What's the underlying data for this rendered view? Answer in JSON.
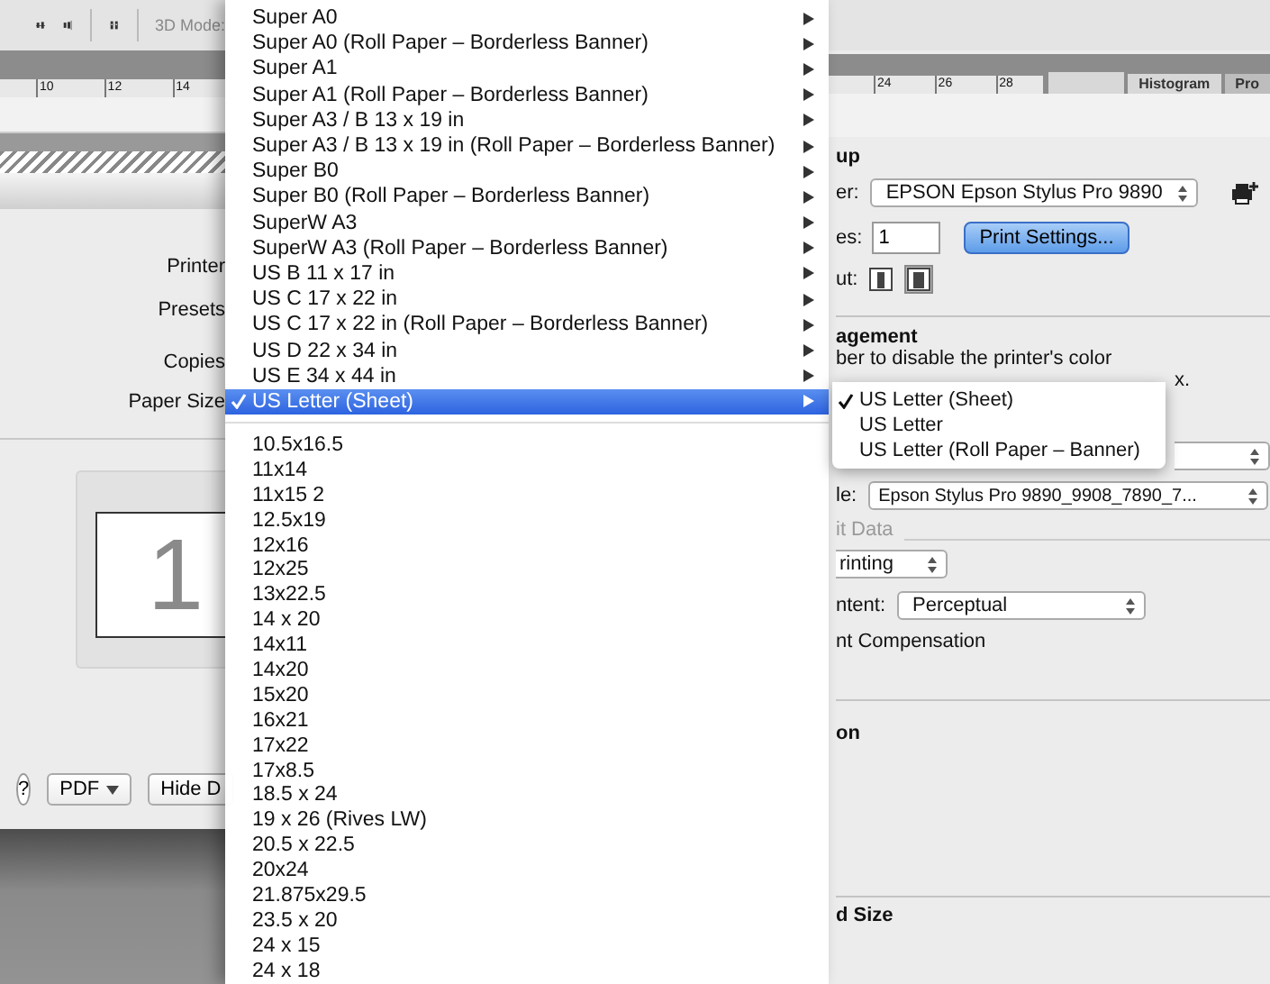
{
  "app_toolbar": {
    "mode_label": "3D Mode:"
  },
  "left_ruler": {
    "ticks": [
      "10",
      "12",
      "14"
    ]
  },
  "right_ruler": {
    "ticks": [
      "24",
      "26",
      "28"
    ]
  },
  "panel_tabs": [
    {
      "label": "Histogram",
      "selected": true
    },
    {
      "label": "Pro",
      "selected": false
    }
  ],
  "print_dialog": {
    "field_labels": [
      "Printer",
      "Presets",
      "Copies",
      "Paper Size"
    ],
    "page_number": "1",
    "help_button": "?",
    "pdf_button": "PDF",
    "hide_button": "Hide D"
  },
  "printer_setup": {
    "heading": "up",
    "printer_label": "er:",
    "printer_value": "EPSON Epson Stylus Pro 9890",
    "copies_label": "es:",
    "copies_value": "1",
    "print_settings_button": "Print Settings...",
    "layout_label": "ut:"
  },
  "color_management": {
    "heading": "agement",
    "note_line_1": "ber to disable the printer's color",
    "note_line_2": "x.",
    "profile_label": "le:",
    "profile_value": "Epson Stylus Pro 9890_9908_7890_7...",
    "data_label": "it Data",
    "printing_value": "rinting",
    "intent_label": "ntent:",
    "intent_value": "Perceptual",
    "compensation_label": "nt Compensation"
  },
  "description_heading": "on",
  "position_heading": "d Size",
  "paper_size_menu": {
    "items": [
      {
        "label": "Super A0",
        "selected": false
      },
      {
        "label": "Super A0 (Roll Paper – Borderless Banner)",
        "selected": false
      },
      {
        "label": "Super A1",
        "selected": false
      },
      {
        "label": "Super A1 (Roll Paper – Borderless Banner)",
        "selected": false
      },
      {
        "label": "Super A3 / B 13 x 19 in",
        "selected": false
      },
      {
        "label": "Super A3 / B 13 x 19 in (Roll Paper – Borderless Banner)",
        "selected": false
      },
      {
        "label": "Super B0",
        "selected": false
      },
      {
        "label": "Super B0 (Roll Paper – Borderless Banner)",
        "selected": false
      },
      {
        "label": "SuperW A3",
        "selected": false
      },
      {
        "label": "SuperW A3 (Roll Paper – Borderless Banner)",
        "selected": false
      },
      {
        "label": "US B 11 x 17 in",
        "selected": false
      },
      {
        "label": "US C 17 x 22 in",
        "selected": false
      },
      {
        "label": "US C 17 x 22 in (Roll Paper – Borderless Banner)",
        "selected": false
      },
      {
        "label": "US D 22 x 34 in",
        "selected": false
      },
      {
        "label": "US E 34 x 44 in",
        "selected": false
      },
      {
        "label": "US Letter (Sheet)",
        "selected": true
      }
    ],
    "custom_sizes": [
      "10.5x16.5",
      "11x14",
      "11x15 2",
      "12.5x19",
      "12x16",
      "12x25",
      "13x22.5",
      "14 x 20",
      "14x11",
      "14x20",
      "15x20",
      "16x21",
      "17x22",
      "17x8.5",
      "18.5 x 24",
      "19 x 26 (Rives LW)",
      "20.5 x 22.5",
      "20x24",
      "21.875x29.5",
      "23.5 x 20",
      "24 x 15",
      "24 x 18"
    ]
  },
  "submenu": {
    "items": [
      {
        "label": "US Letter (Sheet)",
        "checked": true
      },
      {
        "label": "US Letter",
        "checked": false
      },
      {
        "label": "US Letter (Roll Paper – Banner)",
        "checked": false
      }
    ]
  }
}
